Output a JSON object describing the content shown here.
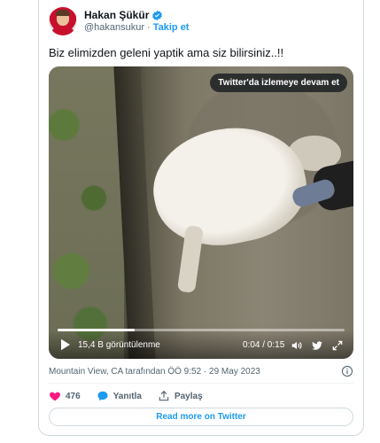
{
  "author": {
    "name": "Hakan Şükür",
    "handle": "@hakansukur",
    "separator": "·",
    "follow_label": "Takip et"
  },
  "tweet": {
    "text": "Biz elimizden geleni yaptik ama siz bilirsiniz..!!"
  },
  "video": {
    "continue_label": "Twitter'da izlemeye devam et",
    "views": "15,4 B görüntülenme",
    "time": "0:04 / 0:15",
    "progress": 0.27
  },
  "meta": {
    "location_time": "Mountain View, CA tarafından ÖÖ 9:52 · 29 May 2023"
  },
  "actions": {
    "likes": "476",
    "reply_label": "Yanıtla",
    "share_label": "Paylaş"
  },
  "read_more_label": "Read more on Twitter",
  "colors": {
    "accent": "#1d9bf0",
    "like": "#f91880",
    "text": "#0f1419",
    "muted": "#536471"
  },
  "icons": {
    "verified": "verified-badge-icon",
    "x_logo": "x-logo-icon",
    "play": "play-icon",
    "volume": "volume-icon",
    "twitter": "twitter-bird-icon",
    "fullscreen": "fullscreen-icon",
    "info": "info-icon",
    "heart": "heart-icon",
    "reply": "reply-bubble-icon",
    "share": "share-icon"
  }
}
